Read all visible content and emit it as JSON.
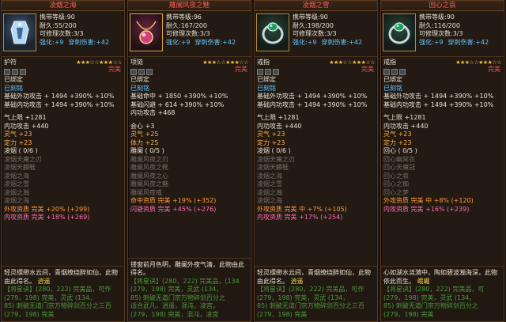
{
  "cards": [
    {
      "title": "凌烟之海",
      "level": "携带等级:90",
      "durability": "耐久:55/200",
      "repair": "可修理次数:3/3",
      "enhance": "强化:+9",
      "pierce": "穿刺伤害:+42",
      "slot_type": "护符",
      "stars": "★★★☆☆★★★☆☆",
      "wonder": "完美",
      "lines": [
        {
          "t": "已绑定",
          "c": "w"
        },
        {
          "t": "已刻铭",
          "c": "b"
        },
        {
          "t": "基础外功攻击 + 1494 +390% +10%",
          "c": "w"
        },
        {
          "t": "基础内功攻击 + 1494 +390% +10%",
          "c": "w"
        },
        {
          "t": "",
          "c": "gap"
        },
        {
          "t": "气上限 +1281",
          "c": "w"
        },
        {
          "t": "内功攻击 +440",
          "c": "w"
        },
        {
          "t": "灵气 +23",
          "c": "o2"
        },
        {
          "t": "定力 +23",
          "c": "o2"
        },
        {
          "t": "凌烟 ( 0/6 )",
          "c": "w"
        },
        {
          "t": "凌烟天魔之刃",
          "c": "gray"
        },
        {
          "t": "凌烟天麟鞋",
          "c": "gray"
        },
        {
          "t": "凌烟之海",
          "c": "gray"
        },
        {
          "t": "凌烟之雪",
          "c": "gray"
        },
        {
          "t": "凌烟之瀚",
          "c": "gray"
        },
        {
          "t": "凌烟之海",
          "c": "gray"
        },
        {
          "t": "外攻资质 完美 +20% (+299)",
          "c": "o"
        },
        {
          "t": "内攻资质 完美 +18% (+269)",
          "c": "pk"
        }
      ],
      "desc": "轻灵缥缈水云间，青烟缭绕醉如仙，此物由此得名。",
      "tag": "逍遥",
      "footer_lines": [
        "【将星诀】(280，222) 完美品，可作",
        "(279，198) 完美，灵武 (134，",
        "85) 刺破无道门宗万物碎剑百分之三百",
        "(279，198) 完美"
      ]
    },
    {
      "title": "雕阑风夜之魅",
      "level": "携带等级:96",
      "durability": "耐久:167/200",
      "repair": "可修理次数:3/3",
      "enhance": "强化:+9",
      "pierce": "穿刺伤害:+42",
      "slot_type": "项链",
      "stars": "★★★☆☆★★★☆☆",
      "wonder": "完美",
      "lines": [
        {
          "t": "已绑定",
          "c": "w"
        },
        {
          "t": "已刻铭",
          "c": "b"
        },
        {
          "t": "基础命中 + 1850 +390% +10%",
          "c": "w"
        },
        {
          "t": "基础闪避 + 614 +390% +10%",
          "c": "w"
        },
        {
          "t": "内功攻击 +468",
          "c": "w"
        },
        {
          "t": "",
          "c": "gap"
        },
        {
          "t": "会心 +3",
          "c": "w"
        },
        {
          "t": "灵气 +25",
          "c": "o2"
        },
        {
          "t": "体力 +25",
          "c": "o2"
        },
        {
          "t": "雕阑 ( 0/5 )",
          "c": "w"
        },
        {
          "t": "雕阑风夜之刃",
          "c": "gray"
        },
        {
          "t": "雕阑风夜之靴",
          "c": "gray"
        },
        {
          "t": "雕阑风夜之心",
          "c": "gray"
        },
        {
          "t": "雕阑风夜之魅",
          "c": "gray"
        },
        {
          "t": "雕阑风夜戒",
          "c": "gray"
        },
        {
          "t": "命中资质 完美 +19% (+352)",
          "c": "o"
        },
        {
          "t": "闪避资质 完美 +45% (+276)",
          "c": "pk"
        }
      ],
      "desc": "镂窗前月色明，雕阑外夜气清，此物由此得名。",
      "tag": "",
      "footer_lines": [
        "【将星诀】(280，222) 完美品，(134",
        "(279，198) 完美，灵武 (134，",
        "85) 刺破无道门宗万物碎剑百分之",
        "适合武凡，逍遥，混沌，凌宫，",
        "(279，198) 完美，混沌，凌宫"
      ]
    },
    {
      "title": "凌烟之雪",
      "level": "携带等级:90",
      "durability": "耐久:198/200",
      "repair": "可修理次数:3/3",
      "enhance": "强化:+9",
      "pierce": "穿刺伤害:+42",
      "slot_type": "戒指",
      "stars": "★★★☆☆★★★☆☆",
      "wonder": "完美",
      "lines": [
        {
          "t": "已绑定",
          "c": "w"
        },
        {
          "t": "已刻铭",
          "c": "b"
        },
        {
          "t": "基础外功攻击 + 1494 +390% +10%",
          "c": "w"
        },
        {
          "t": "基础内功攻击 + 1494 +390% +10%",
          "c": "w"
        },
        {
          "t": "",
          "c": "gap"
        },
        {
          "t": "气上限 +1281",
          "c": "w"
        },
        {
          "t": "内功攻击 +440",
          "c": "w"
        },
        {
          "t": "灵气 +23",
          "c": "o2"
        },
        {
          "t": "定力 +23",
          "c": "o2"
        },
        {
          "t": "凌烟 ( 0/6 )",
          "c": "w"
        },
        {
          "t": "凌烟天魔之刃",
          "c": "gray"
        },
        {
          "t": "凌烟天麟鞋",
          "c": "gray"
        },
        {
          "t": "凌烟之海",
          "c": "gray"
        },
        {
          "t": "凌烟之雪",
          "c": "gray"
        },
        {
          "t": "凌烟之瀚",
          "c": "gray"
        },
        {
          "t": "凌烟之海",
          "c": "gray"
        },
        {
          "t": "外攻资质 完美 中 +7% (+105)",
          "c": "o"
        },
        {
          "t": "内攻资质 完美 +17% (+254)",
          "c": "pk"
        }
      ],
      "desc": "轻灵缥缈水云间，青烟缭绕醉如仙，此物由此得名。",
      "tag": "逍遥",
      "footer_lines": [
        "【将星诀】(280，222) 完美品，可作",
        "(279，198) 完美，灵武 (134，",
        "85) 刺破无道门宗万物碎剑百分之三百",
        "(279，198) 完美"
      ]
    },
    {
      "title": "回心之哀",
      "level": "携带等级:90",
      "durability": "耐久:116/200",
      "repair": "可修理次数:3/3",
      "enhance": "强化:+9",
      "pierce": "穿刺伤害:+42",
      "slot_type": "戒指",
      "stars": "★★★☆☆★★★☆☆",
      "wonder": "完美",
      "lines": [
        {
          "t": "已绑定",
          "c": "w"
        },
        {
          "t": "已刻铭",
          "c": "b"
        },
        {
          "t": "基础外功攻击 + 1494 +390% +10%",
          "c": "w"
        },
        {
          "t": "基础内功攻击 + 1494 +390% +10%",
          "c": "w"
        },
        {
          "t": "",
          "c": "gap"
        },
        {
          "t": "气上限 +1281",
          "c": "w"
        },
        {
          "t": "内功攻击 +440",
          "c": "w"
        },
        {
          "t": "灵气 +23",
          "c": "o2"
        },
        {
          "t": "定力 +23",
          "c": "o2"
        },
        {
          "t": "回心 ( 0/5 )",
          "c": "w"
        },
        {
          "t": "回心幽冥衣",
          "c": "gray"
        },
        {
          "t": "回心天魔冠",
          "c": "gray"
        },
        {
          "t": "回心之哀",
          "c": "gray"
        },
        {
          "t": "回心之痴",
          "c": "gray"
        },
        {
          "t": "回心之梦",
          "c": "gray"
        },
        {
          "t": "外攻资质 完美 中 +8% (+120)",
          "c": "o"
        },
        {
          "t": "内攻资质 完美 +16% (+239)",
          "c": "pk"
        }
      ],
      "desc": "心如湖水涟漪中，陶如碧波瀚海深，此物依此而生。",
      "tag": "峨嵋",
      "footer_lines": [
        "【将星诀】(280，222) 完美品，可",
        "(279，198) 完美，灵武 (134，",
        "85) 刺破无道门宗万物碎剑百分之",
        "(279，198) 完美"
      ]
    }
  ]
}
